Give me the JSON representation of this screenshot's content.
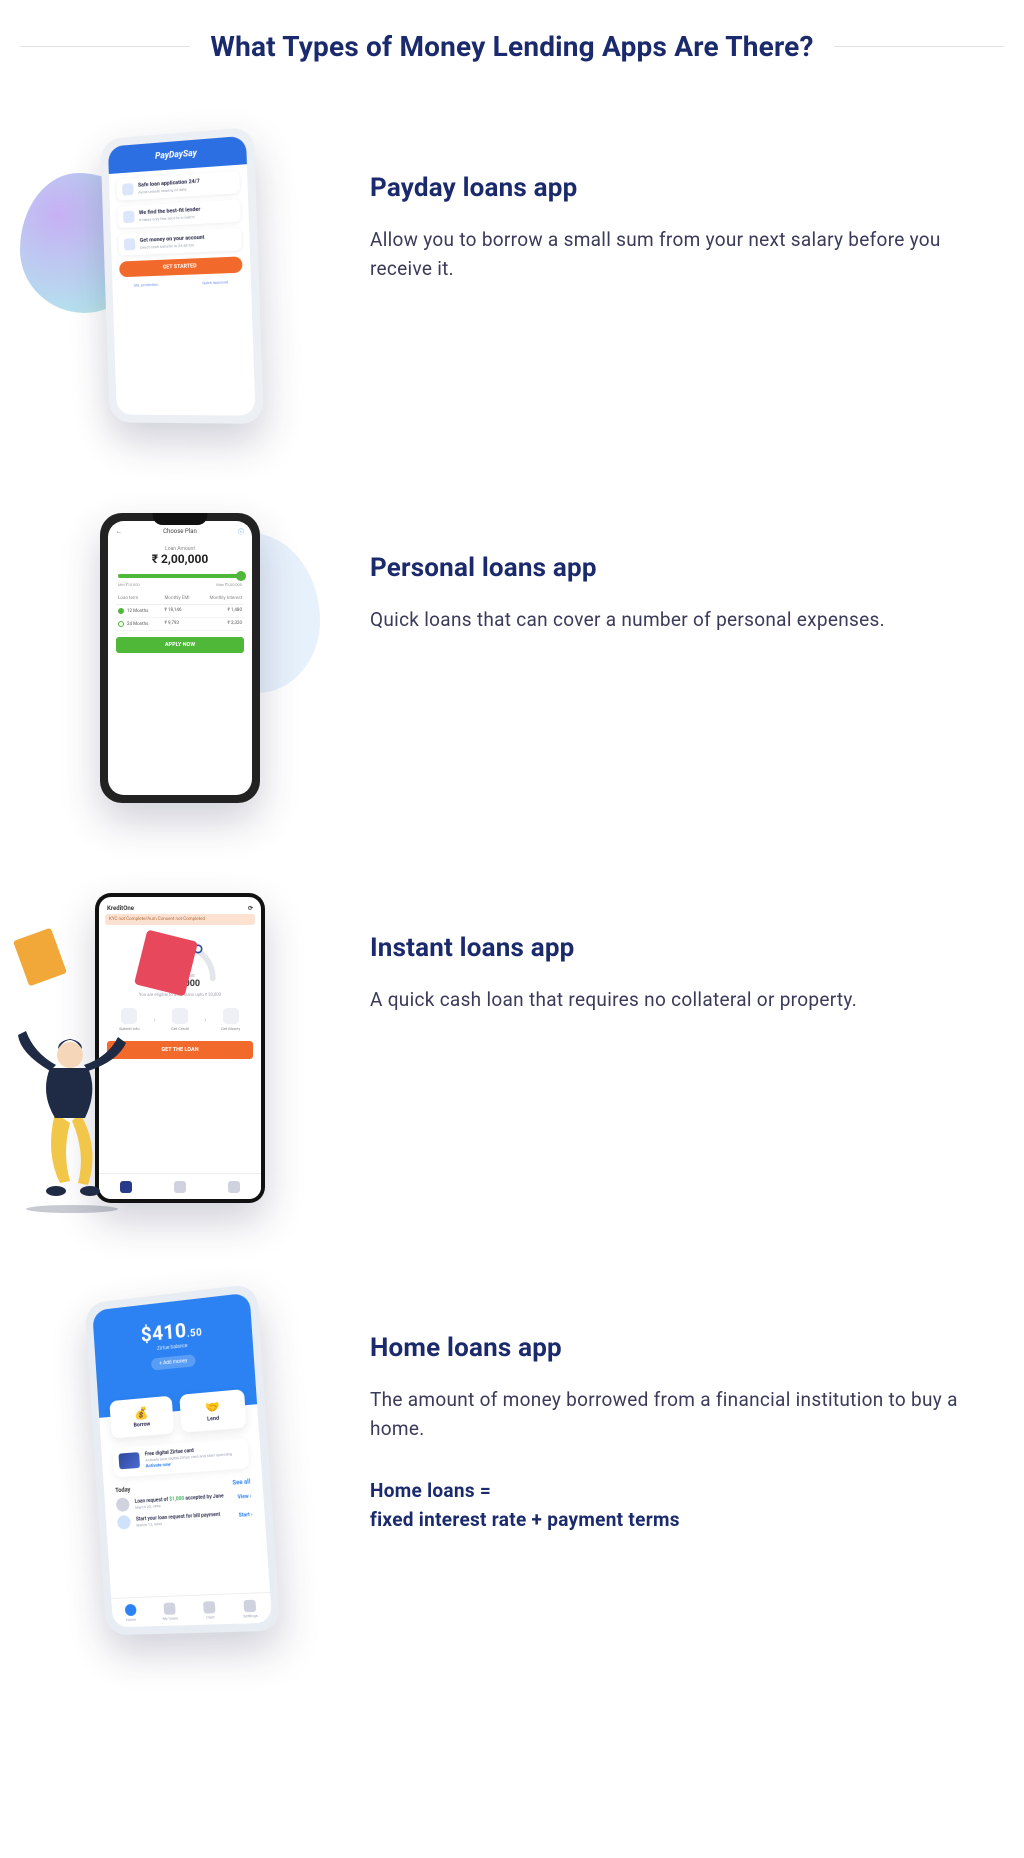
{
  "headline": "What Types of Money Lending Apps Are There?",
  "sections": {
    "payday": {
      "title": "Payday loans app",
      "desc": "Allow you to borrow a small sum from your next salary before you receive it.",
      "phone": {
        "brand": "PayDaySay",
        "card1_title": "Safe loan application 24/7",
        "card1_sub": "Avoid unsafe sharing of data",
        "card2_title": "We find the best-fit lender",
        "card2_sub": "It takes only few secs to a match",
        "card3_title": "Get money on your account",
        "card3_sub": "Direct cash transfer in 24-48 hrs",
        "cta": "GET STARTED",
        "foot1": "SSL protection",
        "foot2": "Quick approval"
      }
    },
    "personal": {
      "title": "Personal loans app",
      "desc": "Quick loans that can cover a number of personal expenses.",
      "phone": {
        "back": "Choose Plan",
        "amount_label": "Loan Amount",
        "amount": "₹ 2,00,000",
        "min": "Min ₹10,000",
        "max": "Max ₹2,00,000",
        "hdr_term": "Loan term",
        "hdr_emi": "Monthly EMI",
        "hdr_int": "Monthly Interest",
        "row1_term": "12 Months",
        "row1_emi": "₹ 18,146",
        "row1_int": "₹ 1,480",
        "row2_term": "24 Months",
        "row2_emi": "₹ 9,793",
        "row2_int": "₹ 2,320",
        "apply": "APPLY NOW"
      }
    },
    "instant": {
      "title": "Instant loans app",
      "desc": "A quick cash loan that requires no collateral or property.",
      "phone": {
        "brand": "KreditOne",
        "banner": "KYC not Complete/Aum Consent not Completed",
        "gauge_label": "Select Amount",
        "gauge_value": "₹ 300,000",
        "eligible": "You are eligible to avail loans upto ₹ 30,000",
        "step1": "Submit info",
        "step2": "Get Credit",
        "step3": "Get Money",
        "cta": "GET THE LOAN"
      }
    },
    "home": {
      "title": "Home loans app",
      "desc": "The amount of money borrowed from a financial institution to buy a home.",
      "formula_l1": "Home loans =",
      "formula_l2": "fixed interest rate + payment terms",
      "phone": {
        "balance_int": "$410",
        "balance_dec": ".50",
        "balance_sub": "Zirtue balance",
        "add": "+ Add money",
        "tile1": "Borrow",
        "tile2": "Lend",
        "card_title": "Free digital Zirtue card",
        "card_sub": "Activate your digital Zirtue card and start spending",
        "card_action": "Activate now",
        "today": "Today",
        "see_all": "See all",
        "li1_prefix": "Loan request of ",
        "li1_amount": "$1,000",
        "li1_suffix": " accepted by Jane",
        "li1_time": "March 20, 4PM",
        "li1_action": "View ›",
        "li2_text": "Start your loan request for bill payment",
        "li2_time": "March 12, 9AM",
        "li2_action": "Start ›",
        "tab1": "Home",
        "tab2": "My loans",
        "tab3": "Card",
        "tab4": "Settings"
      }
    }
  }
}
